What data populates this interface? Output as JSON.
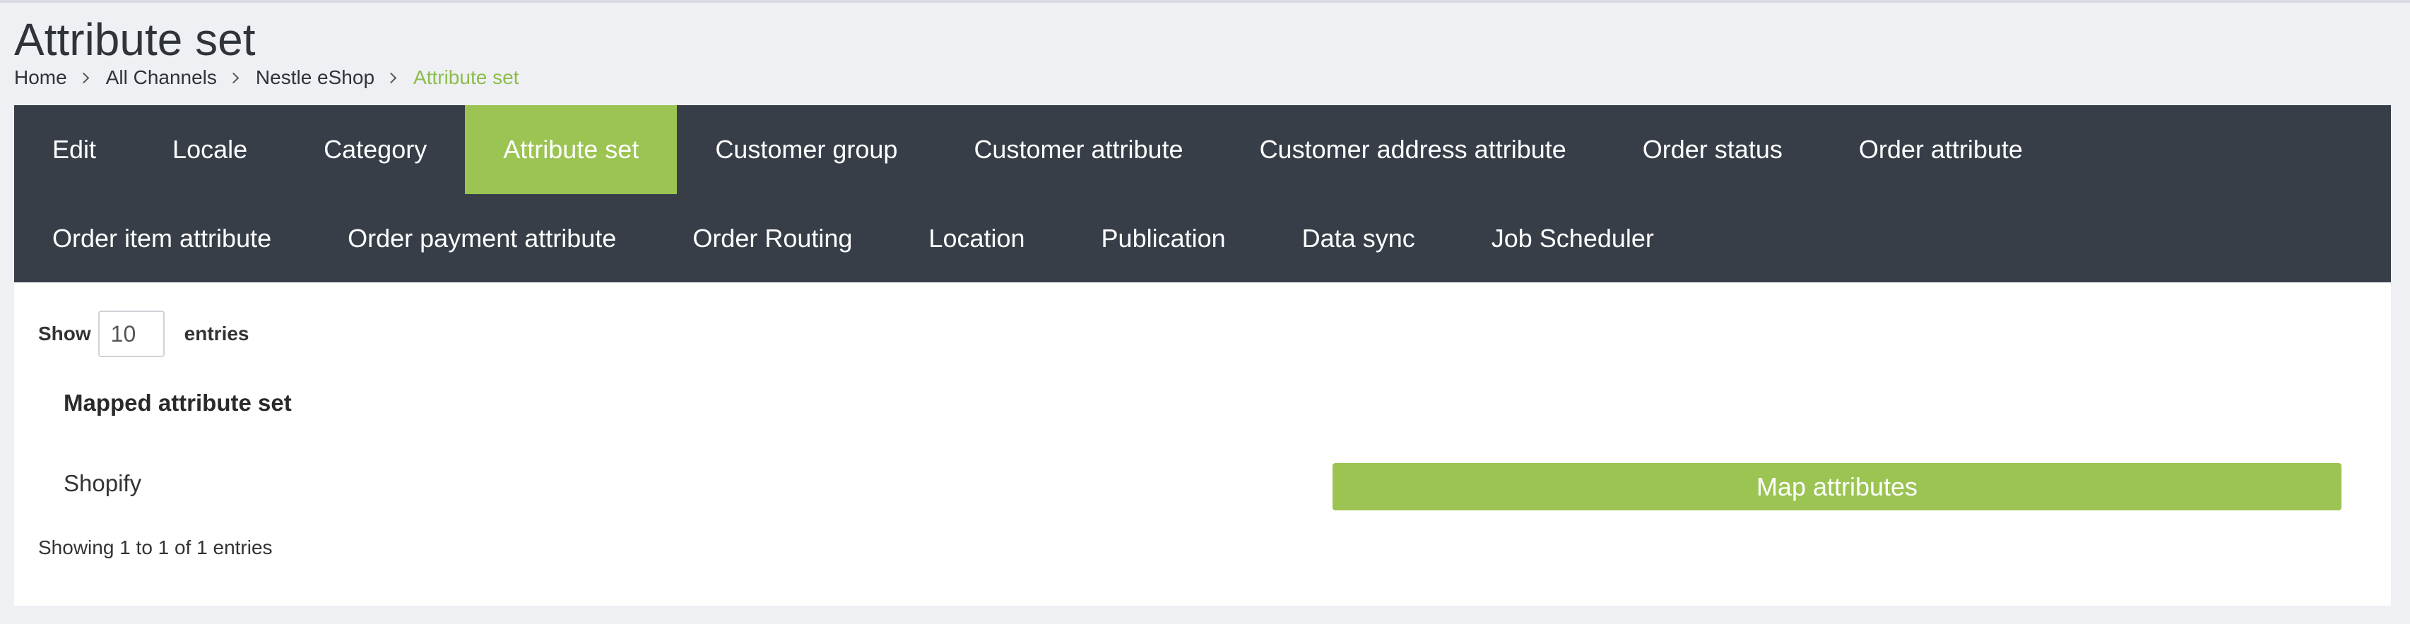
{
  "page": {
    "title": "Attribute set"
  },
  "breadcrumb": [
    "Home",
    "All Channels",
    "Nestle eShop",
    "Attribute set"
  ],
  "tabs": {
    "row1": [
      "Edit",
      "Locale",
      "Category",
      "Attribute set",
      "Customer group",
      "Customer attribute",
      "Customer address attribute",
      "Order status",
      "Order attribute"
    ],
    "row2": [
      "Order item attribute",
      "Order payment attribute",
      "Order Routing",
      "Location",
      "Publication",
      "Data sync",
      "Job Scheduler"
    ],
    "active": "Attribute set"
  },
  "table": {
    "show_label": "Show",
    "page_length": "10",
    "entries_label": "entries",
    "column_header": "Mapped attribute set",
    "rows": [
      {
        "name": "Shopify",
        "action_label": "Map attributes"
      }
    ],
    "info": "Showing 1 to 1 of 1 entries"
  },
  "colors": {
    "accent": "#9bc453",
    "tabbar_bg": "#373e48",
    "breadcrumb_active": "#8dbd4a"
  }
}
